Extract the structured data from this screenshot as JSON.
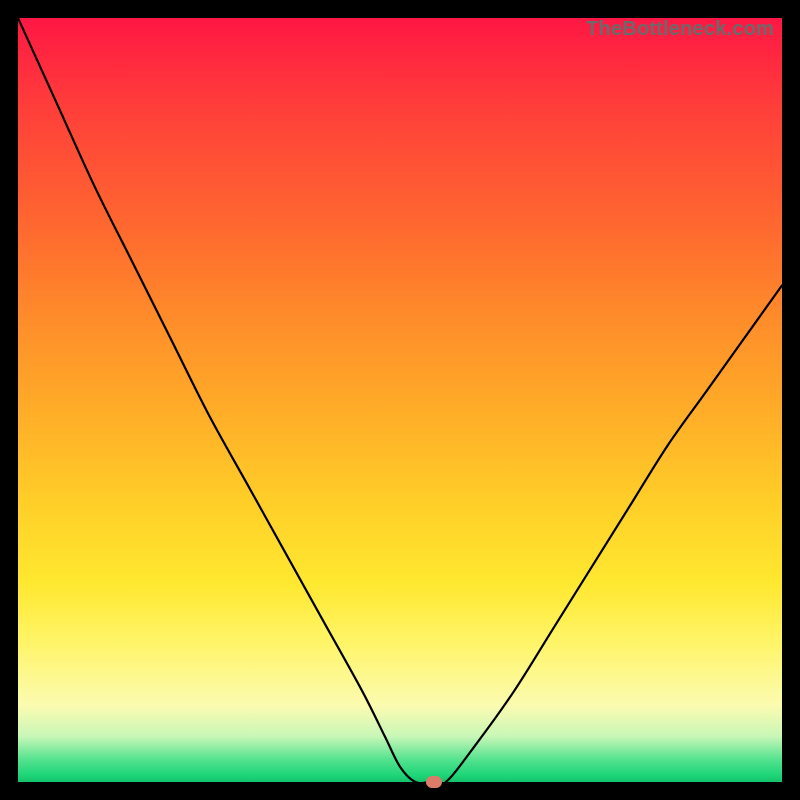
{
  "attribution": "TheBottleneck.com",
  "chart_data": {
    "type": "line",
    "title": "",
    "xlabel": "",
    "ylabel": "",
    "xlim": [
      0,
      100
    ],
    "ylim": [
      0,
      100
    ],
    "x": [
      0,
      5,
      10,
      15,
      20,
      25,
      30,
      35,
      40,
      45,
      48,
      50,
      52,
      54,
      56,
      60,
      65,
      70,
      75,
      80,
      85,
      90,
      95,
      100
    ],
    "values": [
      100,
      89,
      78,
      68,
      58,
      48,
      39,
      30,
      21,
      12,
      6,
      2,
      0,
      0,
      0,
      5,
      12,
      20,
      28,
      36,
      44,
      51,
      58,
      65
    ],
    "marker": {
      "x": 54.5,
      "y": 0
    },
    "gradient_stops": [
      {
        "pos": 0,
        "color": "#ff1744"
      },
      {
        "pos": 50,
        "color": "#ffae28"
      },
      {
        "pos": 80,
        "color": "#fff56a"
      },
      {
        "pos": 100,
        "color": "#14c46a"
      }
    ]
  }
}
